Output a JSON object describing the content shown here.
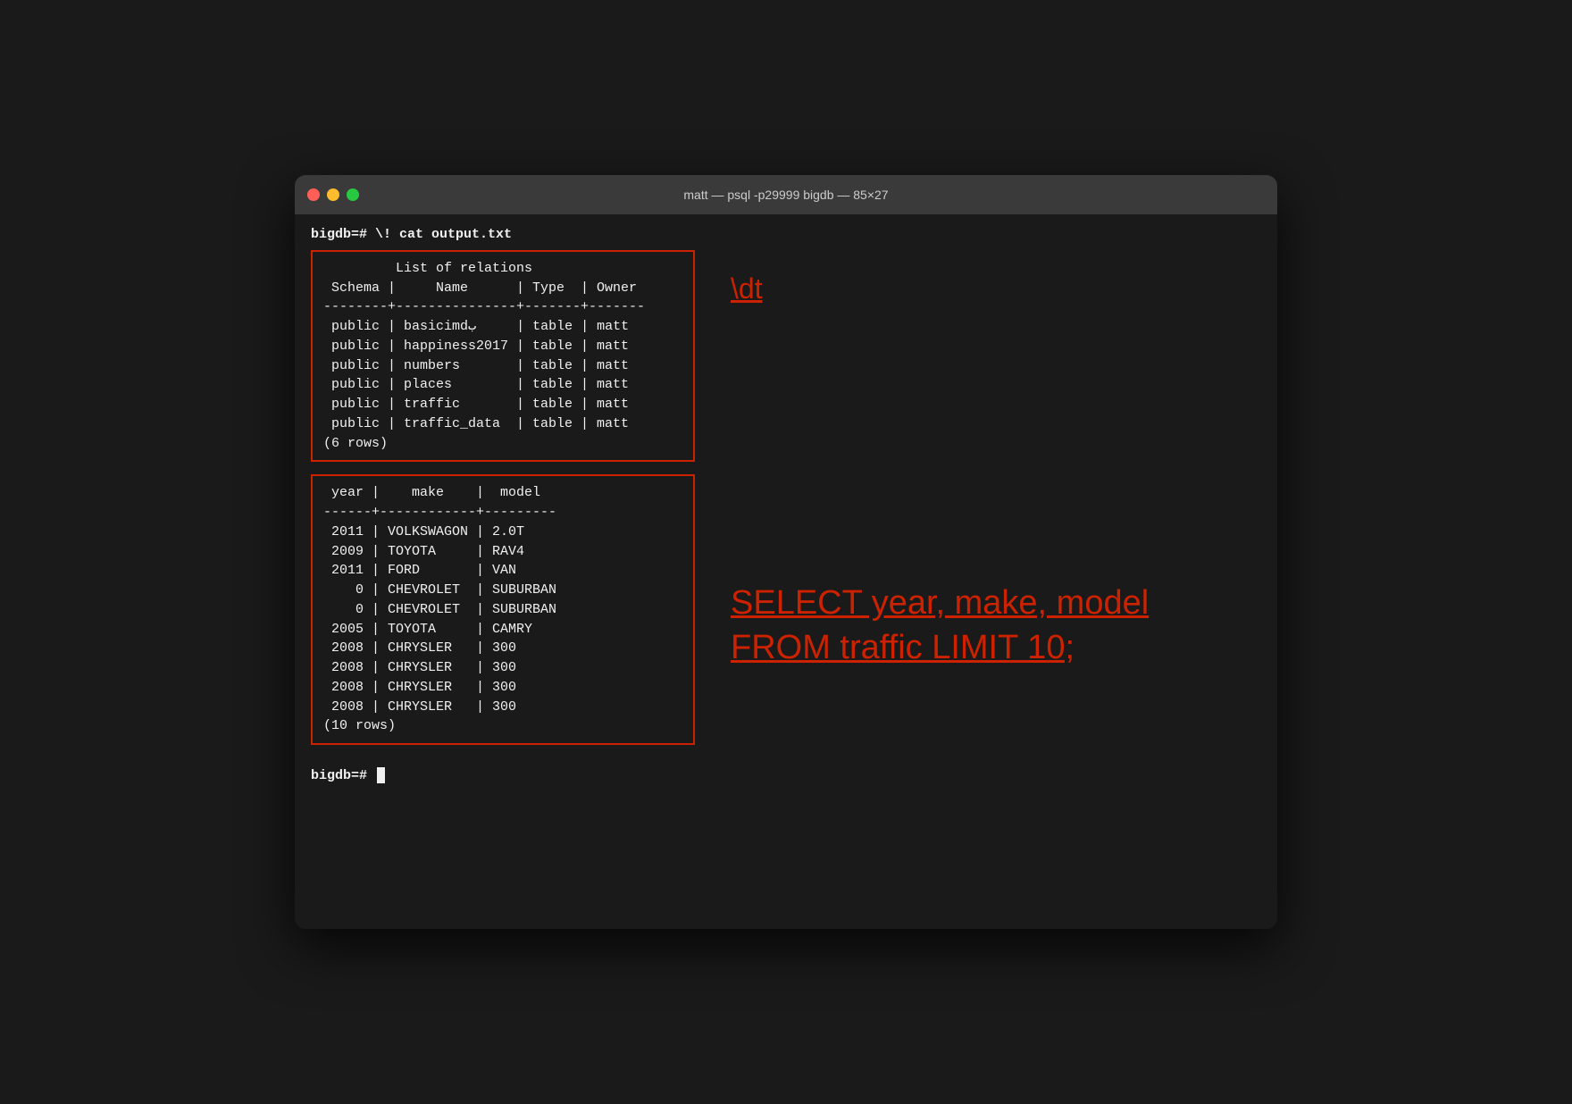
{
  "window": {
    "title": "matt — psql -p29999 bigdb — 85×27",
    "traffic_lights": [
      "red",
      "yellow",
      "green"
    ]
  },
  "terminal": {
    "prompt1": "bigdb=# \\! cat output.txt",
    "table1": {
      "title": "List of relations",
      "header": " Schema |     Name     | Type  | Owner",
      "separator": "--------+--------------+-------+-------",
      "rows": [
        " public | basicimdب    | table | matt",
        " public | happiness2017| table | matt",
        " public | numbers      | table | matt",
        " public | places       | table | matt",
        " public | traffic      | table | matt",
        " public | traffic_data | table | matt"
      ],
      "footer": "(6 rows)"
    },
    "table2": {
      "header": " year |    make    |  model",
      "separator": "------+------------+---------",
      "rows": [
        " 2011 | VOLKSWAGON | 2.0T",
        " 2009 | TOYOTA     | RAV4",
        " 2011 | FORD       | VAN",
        "    0 | CHEVROLET  | SUBURBAN",
        "    0 | CHEVROLET  | SUBURBAN",
        " 2005 | TOYOTA     | CAMRY",
        " 2008 | CHRYSLER   | 300",
        " 2008 | CHRYSLER   | 300",
        " 2008 | CHRYSLER   | 300",
        " 2008 | CHRYSLER   | 300"
      ],
      "footer": "(10 rows)"
    },
    "annotation_dt": "\\dt",
    "annotation_query_line1": "SELECT year, make, model",
    "annotation_query_line2": "FROM traffic LIMIT 10;",
    "bottom_prompt": "bigdb=# "
  }
}
